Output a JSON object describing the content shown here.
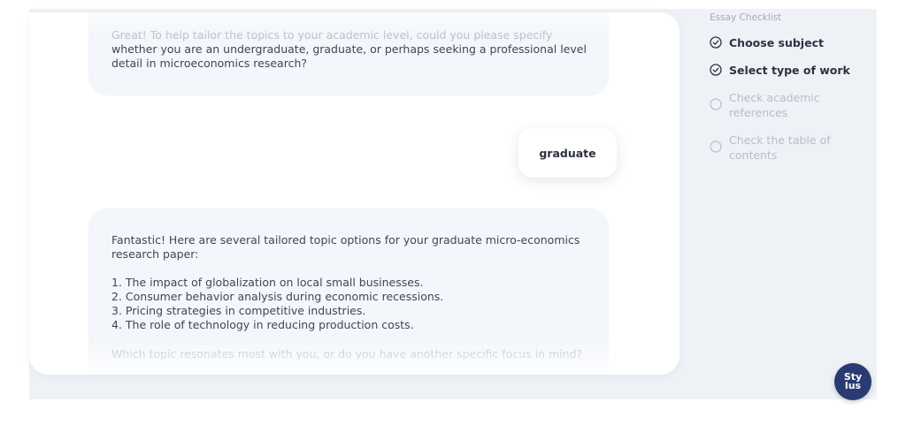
{
  "chat": {
    "message1": {
      "lines": [
        "Great! To help tailor the topics to your academic level, could you please specify",
        "whether you are an undergraduate, graduate, or perhaps seeking a professional level",
        "detail in microeconomics research?"
      ]
    },
    "user_reply": "graduate",
    "message2": {
      "intro_lines": [
        "Fantastic! Here are several tailored topic options for your graduate micro-economics",
        "research paper:"
      ],
      "topics": [
        "1. The impact of globalization on local small businesses.",
        "2. Consumer behavior analysis during economic recessions.",
        "3. Pricing strategies in competitive industries.",
        "4. The role of technology in reducing production costs."
      ],
      "question": "Which topic resonates most with you, or do you have another specific focus in mind?"
    }
  },
  "checklist": {
    "title": "Essay Checklist",
    "items": [
      {
        "label": "Choose subject",
        "status": "done"
      },
      {
        "label": "Select type of work",
        "status": "done"
      },
      {
        "label": "Check academic references",
        "status": "todo"
      },
      {
        "label": "Check the table of contents",
        "status": "todo"
      }
    ]
  },
  "logo": {
    "line1": "Sty",
    "line2": "lus"
  },
  "colors": {
    "brand": "#2a3a72",
    "text": "#3f4657",
    "muted": "#b6bdc9",
    "panel_bg": "#eef2f7"
  }
}
